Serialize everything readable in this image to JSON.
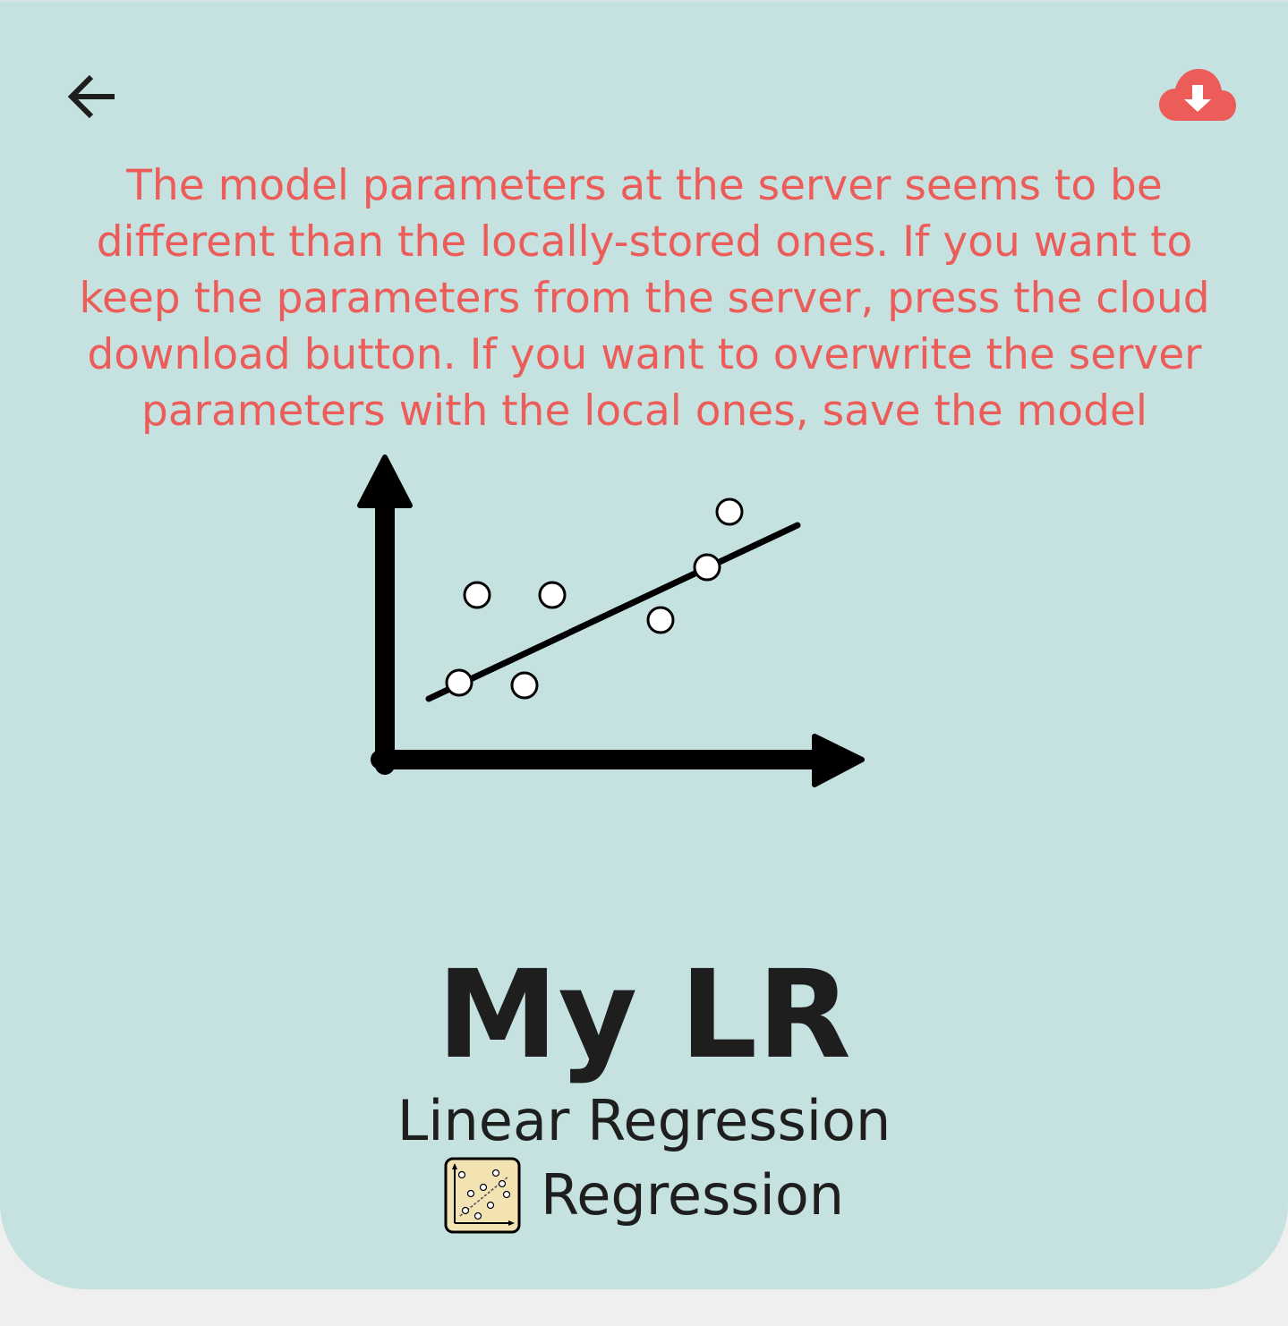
{
  "header": {
    "back_icon": "arrow-left-icon",
    "download_icon": "cloud-download-icon",
    "download_color": "#ec5d59"
  },
  "warning": {
    "text": "The model parameters at the server seems to be different than the locally-stored ones. If you want to keep the parameters from the server, press the cloud download button. If you want to overwrite the server parameters with the local ones, save the model",
    "color": "#ec5d59"
  },
  "illustration": {
    "icon": "linear-regression-illustration"
  },
  "model": {
    "name": "My LR",
    "type": "Linear Regression",
    "category": "Regression",
    "category_icon": "regression-chart-icon"
  },
  "colors": {
    "background": "#c5e2e1",
    "text": "#1e1e1e"
  }
}
